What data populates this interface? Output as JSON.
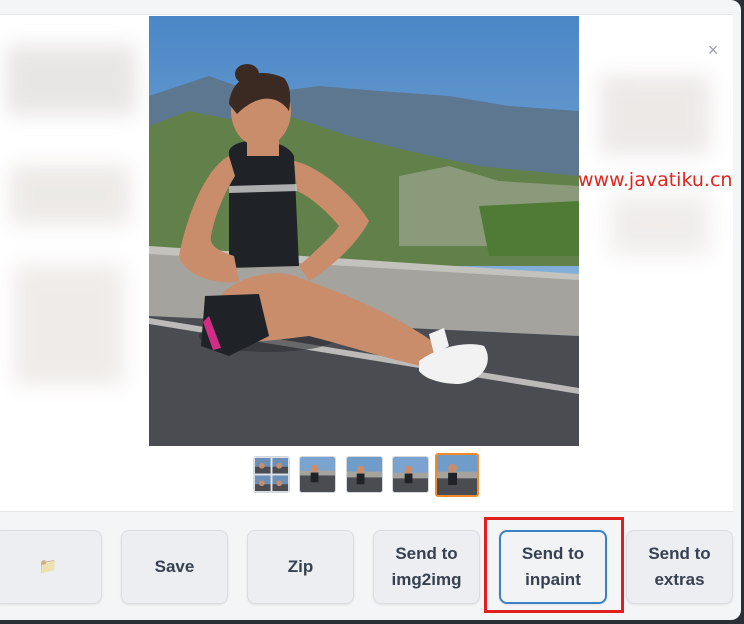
{
  "gallery": {
    "close_glyph": "×",
    "watermark": "www.javatiku.cn",
    "main_image_icon": "photo-woman-sitting-on-road",
    "thumbnails": [
      {
        "icon": "thumbnail-grid-image",
        "selected": false
      },
      {
        "icon": "thumbnail-image",
        "selected": false
      },
      {
        "icon": "thumbnail-image",
        "selected": false
      },
      {
        "icon": "thumbnail-image",
        "selected": false
      },
      {
        "icon": "thumbnail-image",
        "selected": true
      }
    ]
  },
  "actions": {
    "folder_icon": "📁",
    "save_label": "Save",
    "zip_label": "Zip",
    "send_img2img_label": "Send to\nimg2img",
    "send_inpaint_label": "Send to\ninpaint",
    "send_extras_label": "Send to\nextras"
  },
  "colors": {
    "accent_focus": "#3b82c4",
    "highlight_red": "#e01f1f",
    "selected_thumb": "#f08a2a"
  }
}
